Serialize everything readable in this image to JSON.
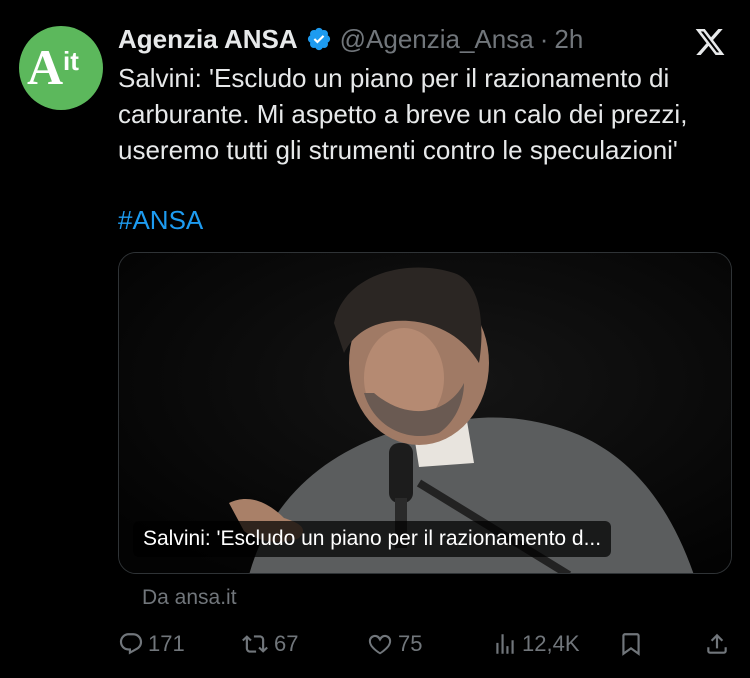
{
  "author": {
    "display_name": "Agenzia ANSA",
    "handle": "@Agenzia_Ansa",
    "separator": "·",
    "time": "2h",
    "avatar_text": "Ait",
    "avatar_color": "#5cb85c",
    "verified": true
  },
  "tweet": {
    "text": "Salvini: 'Escludo un piano per il razionamento di carburante. Mi aspetto a breve un calo dei prezzi, useremo tutti gli strumenti contro le speculazioni'",
    "hashtag": "#ANSA"
  },
  "card": {
    "caption": "Salvini: 'Escludo un piano per il razionamento d...",
    "source": "Da ansa.it"
  },
  "actions": {
    "replies": "171",
    "reposts": "67",
    "likes": "75",
    "views": "12,4K"
  },
  "colors": {
    "background": "#000000",
    "text": "#e7e9ea",
    "muted": "#71767b",
    "link": "#1d9bf0",
    "verified": "#1d9bf0"
  },
  "icons": [
    "verified-badge-icon",
    "x-logo-icon",
    "reply-icon",
    "repost-icon",
    "like-icon",
    "views-icon",
    "bookmark-icon",
    "share-icon"
  ]
}
